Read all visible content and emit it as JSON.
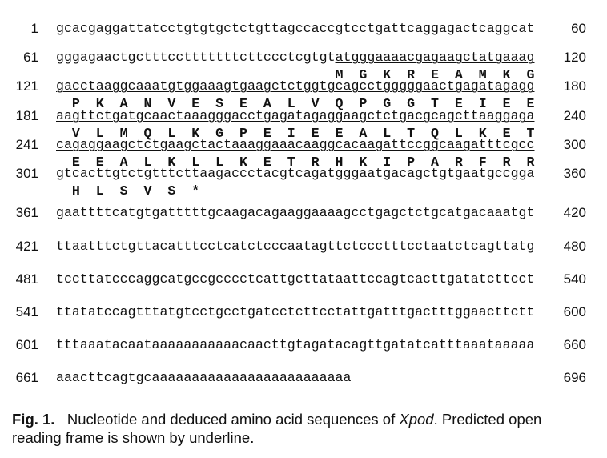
{
  "figure": {
    "rows": [
      {
        "start": "1",
        "pre": "gcacgaggattatcctgtgtgctctgttagccaccgtcctgattcaggagactcaggcat",
        "orf": "",
        "post": "",
        "end": "60",
        "aa": ""
      },
      {
        "start": "61",
        "pre": "gggagaactgctttcctttttttcttccctcgtgt",
        "orf": "atgggaaaacgagaagctatgaaag",
        "post": "",
        "end": "120",
        "aa": "                                   M  G  K  R  E  A  M  K  G"
      },
      {
        "start": "121",
        "pre": "",
        "orf": "gacctaaggcaaatgtggaaagtgaagctctggtgcagcctggggg aactgagatagagg",
        "post": "",
        "end": "180",
        "aa": "  P  K  A  N  V  E  S  E  A  L  V  Q  P  G  G  T  E  I  E  E"
      },
      {
        "start": "181",
        "pre": "",
        "orf": "aagttctgatgcaactaaagggacctgagatagaggaagctctgacgcagcttaaggaga",
        "post": "",
        "end": "240",
        "aa": "  V  L  M  Q  L  K  G  P  E  I  E  E  A  L  T  Q  L  K  E  T"
      },
      {
        "start": "241",
        "pre": "",
        "orf": "cagaggaagctctgaagctactaaaggaaacaaggcacaagattccggcaagatttcgcc",
        "post": "",
        "end": "300",
        "aa": "  E  E  A  L  K  L  L  K  E  T  R  H  K  I  P  A  R  F  R  R"
      },
      {
        "start": "301",
        "pre": "",
        "orf": "gtcacttgtctgtttcttaa",
        "post": "gaccctacgtcagatgggaatgacagctgtgaatgccgga",
        "end": "360",
        "aa": "  H  L  S  V  S  *"
      },
      {
        "start": "361",
        "pre": "gaattttcatgtgatttttgcaagacagaaggaaaagcctgagctctgcatgacaaatgt",
        "orf": "",
        "post": "",
        "end": "420",
        "aa": ""
      },
      {
        "start": "421",
        "pre": "ttaatttctgttacatttcctcatctcccaatagttctccctttcctaatctcagttatg",
        "orf": "",
        "post": "",
        "end": "480",
        "aa": ""
      },
      {
        "start": "481",
        "pre": "tccttatcccaggcatgccgcccctcattgcttataattccagtcacttgatatcttcct",
        "orf": "",
        "post": "",
        "end": "540",
        "aa": ""
      },
      {
        "start": "541",
        "pre": "ttatatccagtttatgtcctgcctgatcctcttcctattgatttgactttggaacttctt",
        "orf": "",
        "post": "",
        "end": "600",
        "aa": ""
      },
      {
        "start": "601",
        "pre": "tttaaatacaataaaaaaaaaaacaacttgtagatacagttgatatcatttaaataaaaa",
        "orf": "",
        "post": "",
        "end": "660",
        "aa": ""
      },
      {
        "start": "661",
        "pre": "aaacttcagtgcaaaaaaaaaaaaaaaaaaaaaaaaa",
        "orf": "",
        "post": "",
        "end": "696",
        "aa": ""
      }
    ]
  },
  "caption": {
    "label": "Fig. 1.",
    "text_before": "Nucleotide and deduced amino acid sequences of ",
    "gene": "Xpod",
    "text_after": ". Predicted open reading frame is shown by underline."
  }
}
